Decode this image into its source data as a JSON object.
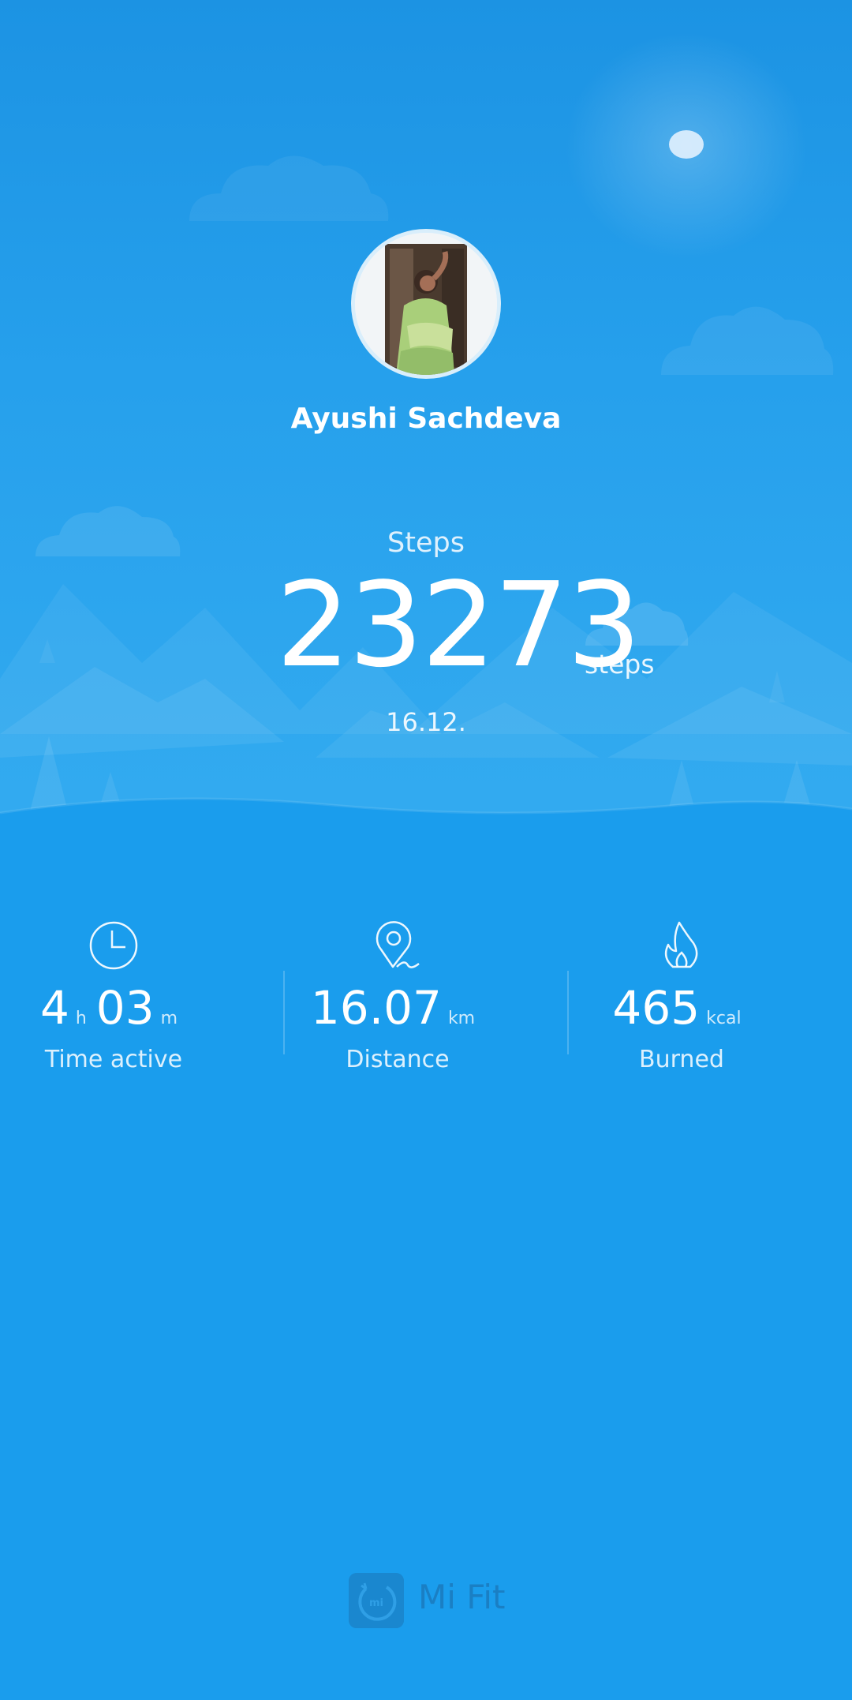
{
  "profile": {
    "name": "Ayushi Sachdeva"
  },
  "steps": {
    "label": "Steps",
    "value": "23273",
    "unit": "steps",
    "date": "16.12."
  },
  "stats": {
    "time_active": {
      "hours": "4",
      "hours_unit": "h",
      "minutes": "03",
      "minutes_unit": "m",
      "label": "Time active",
      "icon": "clock-icon"
    },
    "distance": {
      "value": "16.07",
      "unit": "km",
      "label": "Distance",
      "icon": "location-pin-icon"
    },
    "burned": {
      "value": "465",
      "unit": "kcal",
      "label": "Burned",
      "icon": "flame-icon"
    }
  },
  "brand": {
    "name": "Mi Fit",
    "icon": "mi-logo-icon"
  },
  "colors": {
    "background": "#1a9ded",
    "brand_text": "#1a7fc4"
  }
}
